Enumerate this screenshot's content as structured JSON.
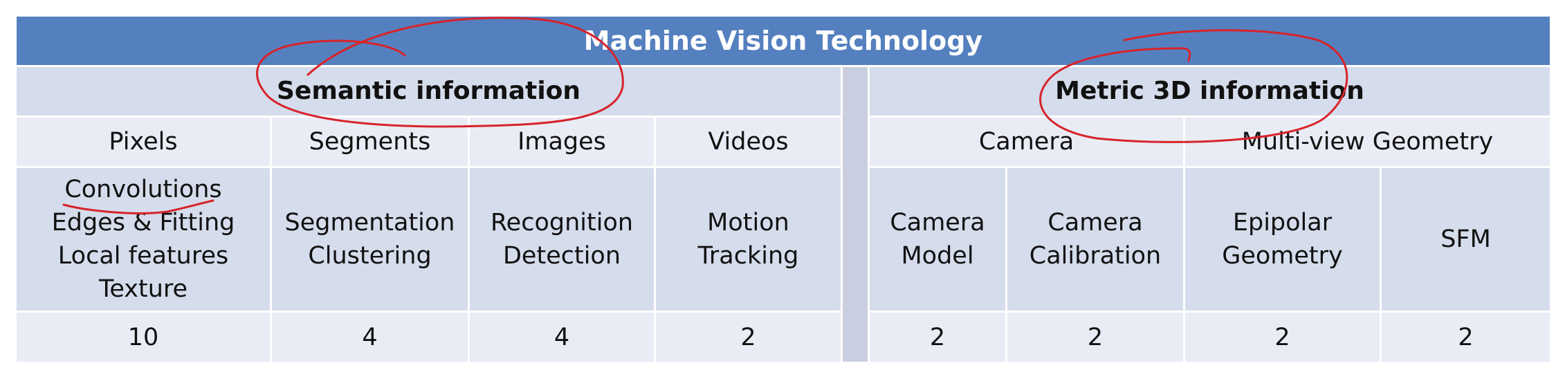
{
  "table": {
    "title": "Machine Vision Technology",
    "groups": [
      {
        "label": "Semantic information"
      },
      {
        "label": "Metric 3D information"
      }
    ],
    "subcategories": [
      {
        "label": "Pixels"
      },
      {
        "label": "Segments"
      },
      {
        "label": "Images"
      },
      {
        "label": "Videos"
      },
      {
        "label": "Camera"
      },
      {
        "label": "Multi-view Geometry"
      }
    ],
    "topics": [
      {
        "lines": [
          "Convolutions",
          "Edges & Fitting",
          "Local features",
          "Texture"
        ]
      },
      {
        "lines": [
          "Segmentation",
          "Clustering"
        ]
      },
      {
        "lines": [
          "Recognition",
          "Detection"
        ]
      },
      {
        "lines": [
          "Motion",
          "Tracking"
        ]
      },
      {
        "lines": [
          "Camera",
          "Model"
        ]
      },
      {
        "lines": [
          "Camera",
          "Calibration"
        ]
      },
      {
        "lines": [
          "Epipolar",
          "Geometry"
        ]
      },
      {
        "lines": [
          "SFM"
        ]
      }
    ],
    "counts": [
      "10",
      "4",
      "4",
      "2",
      "2",
      "2",
      "2",
      "2"
    ]
  },
  "colors": {
    "header": "#5580bf",
    "group_row": "#d5dceb",
    "light_row": "#e9ecf5",
    "annotation": "#d8232a"
  }
}
